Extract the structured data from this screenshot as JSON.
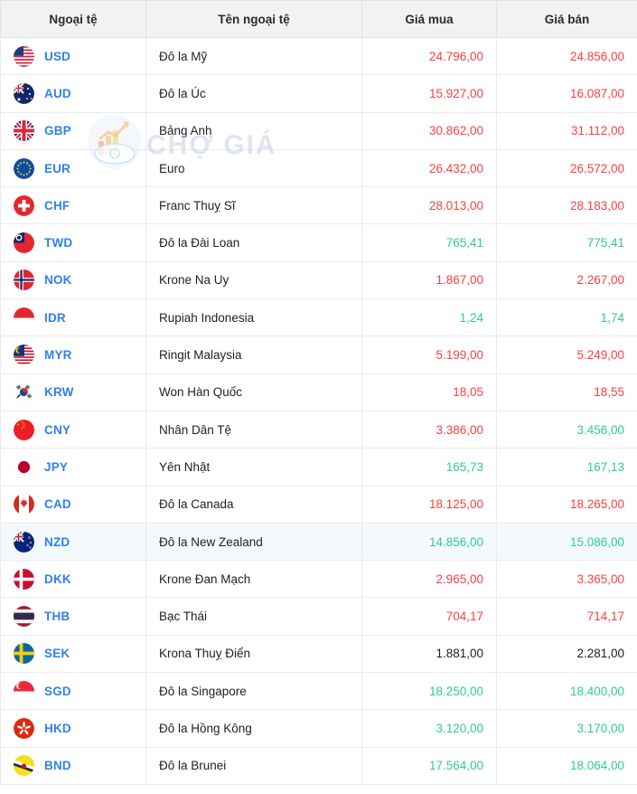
{
  "table": {
    "headers": {
      "currency": "Ngoại tệ",
      "name": "Tên ngoại tệ",
      "buy": "Giá mua",
      "sell": "Giá bán"
    },
    "rows": [
      {
        "code": "USD",
        "flag": "flag-us",
        "name": "Đô la Mỹ",
        "buy": "24.796,00",
        "sell": "24.856,00",
        "buy_trend": "down",
        "sell_trend": "down",
        "highlight": false
      },
      {
        "code": "AUD",
        "flag": "flag-au",
        "name": "Đô la Úc",
        "buy": "15.927,00",
        "sell": "16.087,00",
        "buy_trend": "down",
        "sell_trend": "down",
        "highlight": false
      },
      {
        "code": "GBP",
        "flag": "flag-gb",
        "name": "Bảng Anh",
        "buy": "30.862,00",
        "sell": "31.112,00",
        "buy_trend": "down",
        "sell_trend": "down",
        "highlight": false
      },
      {
        "code": "EUR",
        "flag": "flag-eu",
        "name": "Euro",
        "buy": "26.432,00",
        "sell": "26.572,00",
        "buy_trend": "down",
        "sell_trend": "down",
        "highlight": false
      },
      {
        "code": "CHF",
        "flag": "flag-ch",
        "name": "Franc Thuỵ Sĩ",
        "buy": "28.013,00",
        "sell": "28.183,00",
        "buy_trend": "down",
        "sell_trend": "down",
        "highlight": false
      },
      {
        "code": "TWD",
        "flag": "flag-tw",
        "name": "Đô la Đài Loan",
        "buy": "765,41",
        "sell": "775,41",
        "buy_trend": "up",
        "sell_trend": "up",
        "highlight": false
      },
      {
        "code": "NOK",
        "flag": "flag-no",
        "name": "Krone Na Uy",
        "buy": "1.867,00",
        "sell": "2.267,00",
        "buy_trend": "down",
        "sell_trend": "down",
        "highlight": false
      },
      {
        "code": "IDR",
        "flag": "flag-id",
        "name": "Rupiah Indonesia",
        "buy": "1,24",
        "sell": "1,74",
        "buy_trend": "up",
        "sell_trend": "up",
        "highlight": false
      },
      {
        "code": "MYR",
        "flag": "flag-my",
        "name": "Ringit Malaysia",
        "buy": "5.199,00",
        "sell": "5.249,00",
        "buy_trend": "down",
        "sell_trend": "down",
        "highlight": false
      },
      {
        "code": "KRW",
        "flag": "flag-kr",
        "name": "Won Hàn Quốc",
        "buy": "18,05",
        "sell": "18,55",
        "buy_trend": "down",
        "sell_trend": "down",
        "highlight": false
      },
      {
        "code": "CNY",
        "flag": "flag-cn",
        "name": "Nhân Dân Tệ",
        "buy": "3.386,00",
        "sell": "3.456,00",
        "buy_trend": "down",
        "sell_trend": "up",
        "highlight": false
      },
      {
        "code": "JPY",
        "flag": "flag-jp",
        "name": "Yên Nhật",
        "buy": "165,73",
        "sell": "167,13",
        "buy_trend": "up",
        "sell_trend": "up",
        "highlight": false
      },
      {
        "code": "CAD",
        "flag": "flag-ca",
        "name": "Đô la Canada",
        "buy": "18.125,00",
        "sell": "18.265,00",
        "buy_trend": "down",
        "sell_trend": "down",
        "highlight": false
      },
      {
        "code": "NZD",
        "flag": "flag-nz",
        "name": "Đô la New Zealand",
        "buy": "14.856,00",
        "sell": "15.086,00",
        "buy_trend": "up",
        "sell_trend": "up",
        "highlight": true
      },
      {
        "code": "DKK",
        "flag": "flag-dk",
        "name": "Krone Đan Mạch",
        "buy": "2.965,00",
        "sell": "3.365,00",
        "buy_trend": "down",
        "sell_trend": "down",
        "highlight": false
      },
      {
        "code": "THB",
        "flag": "flag-th",
        "name": "Bạc Thái",
        "buy": "704,17",
        "sell": "714,17",
        "buy_trend": "down",
        "sell_trend": "down",
        "highlight": false
      },
      {
        "code": "SEK",
        "flag": "flag-se",
        "name": "Krona Thuỵ Điển",
        "buy": "1.881,00",
        "sell": "2.281,00",
        "buy_trend": "flat",
        "sell_trend": "flat",
        "highlight": false
      },
      {
        "code": "SGD",
        "flag": "flag-sg",
        "name": "Đô la Singapore",
        "buy": "18.250,00",
        "sell": "18.400,00",
        "buy_trend": "up",
        "sell_trend": "up",
        "highlight": false
      },
      {
        "code": "HKD",
        "flag": "flag-hk",
        "name": "Đô la Hồng Kông",
        "buy": "3.120,00",
        "sell": "3.170,00",
        "buy_trend": "up",
        "sell_trend": "up",
        "highlight": false
      },
      {
        "code": "BND",
        "flag": "flag-bn",
        "name": "Đô la Brunei",
        "buy": "17.564,00",
        "sell": "18.064,00",
        "buy_trend": "up",
        "sell_trend": "up",
        "highlight": false
      }
    ]
  },
  "watermark": {
    "text": "CHỢ GIÁ"
  },
  "colors": {
    "up": "#2ecc8f",
    "down": "#f8403f",
    "flat": "#1d1d1d",
    "link": "#2f80ed",
    "header_bg": "#f2f2f2",
    "highlight_bg": "#f4f9fd"
  }
}
